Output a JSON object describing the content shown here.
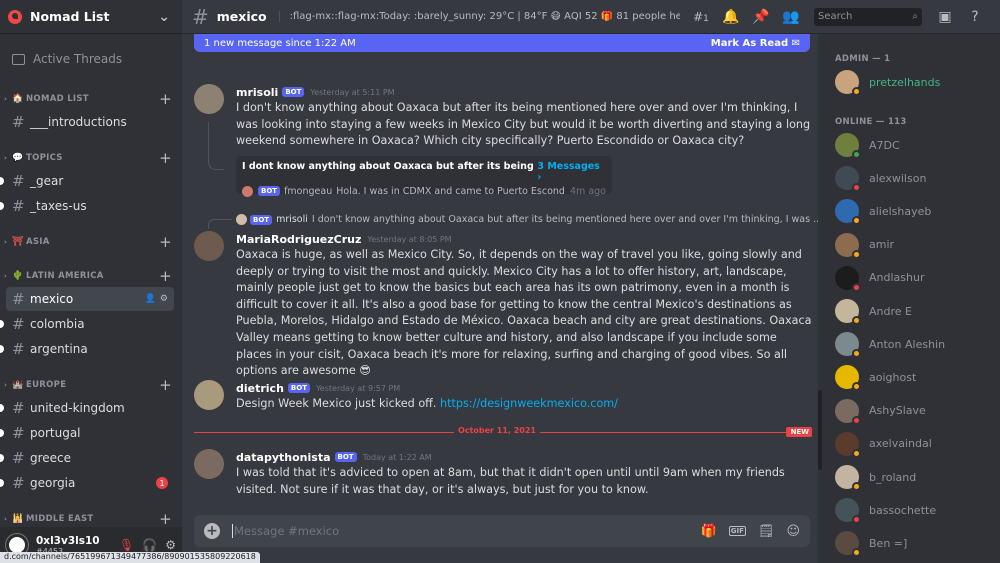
{
  "server": {
    "name": "Nomad List"
  },
  "sidebar": {
    "active_threads": "Active Threads",
    "categories": [
      {
        "name": "NOMAD LIST",
        "emoji": "🏠",
        "channels": [
          {
            "name": "___introductions",
            "unread": false
          }
        ]
      },
      {
        "name": "TOPICS",
        "emoji": "💬",
        "channels": [
          {
            "name": "_gear",
            "unread": true
          },
          {
            "name": "_taxes-us",
            "unread": true
          }
        ]
      },
      {
        "name": "ASIA",
        "emoji": "⛩",
        "channels": []
      },
      {
        "name": "LATIN AMERICA",
        "emoji": "🌵",
        "channels": [
          {
            "name": "mexico",
            "selected": true
          },
          {
            "name": "colombia",
            "unread": true
          },
          {
            "name": "argentina",
            "unread": true
          }
        ]
      },
      {
        "name": "EUROPE",
        "emoji": "🏰",
        "channels": [
          {
            "name": "united-kingdom",
            "unread": true
          },
          {
            "name": "portugal",
            "unread": true
          },
          {
            "name": "greece",
            "unread": true
          },
          {
            "name": "georgia",
            "unread": true,
            "badge": "1"
          }
        ]
      },
      {
        "name": "MIDDLE EAST",
        "emoji": "🕌",
        "channels": []
      }
    ]
  },
  "user": {
    "name": "0xl3v3ls10",
    "tag": "#4453"
  },
  "status_url": "d.com/channels/765199671349477386/890901535809220618",
  "topbar": {
    "channel": "mexico",
    "topic": ":flag-mx::flag-mx:Today: :barely_sunny: 29°C | 84°F 😷 AQI 52 🎁 81 people here now [ ...",
    "thread_count": "1",
    "search_placeholder": "Search"
  },
  "banner": {
    "text": "1 new message since 1:22 AM",
    "action": "Mark As Read"
  },
  "messages": [
    {
      "author": "mrisoli",
      "bot": "BOT",
      "time": "Yesterday at 5:11 PM",
      "text": "I don't know anything about Oaxaca but after its being mentioned here over and over I'm thinking, I was looking into staying a few weeks in Mexico City but would it be worth diverting and staying a long weekend somewhere in Oaxaca? Which city specifically? Puerto Escondido or Oaxaca city?",
      "thread": {
        "title": "I dont know anything about Oaxaca but after its being mentione...",
        "count": "3 Messages ›",
        "last_bot": "BOT",
        "last_user": "fmongeau",
        "last_text": "Hola. I was in CDMX and came to Puerto Escondid...",
        "last_time": "4m ago"
      }
    },
    {
      "reply": {
        "bot": "BOT",
        "user": "mrisoli",
        "text": "I don't know anything about Oaxaca but after its being mentioned here over and over I'm thinking, I was ..."
      },
      "author": "MariaRodriguezCruz",
      "time": "Yesterday at 8:05 PM",
      "text": "Oaxaca is huge, as well as Mexico City. So, it depends on the way of travel you like, going slowly and deeply or trying to visit the most and quickly. Mexico City has a lot to offer history, art, landscape, mainly people just get to know the basics but each area has its own patrimony, even in a month is difficult to cover it all. It's also a good base for getting to know the central Mexico's destinations as Puebla, Morelos, Hidalgo and Estado de México. Oaxaca beach and city are great destinations. Oaxaca Valley means getting to know better culture and history, and also landscape if you include some places in your cisit, Oaxaca beach it's more for relaxing, surfing and charging of good vibes.  So all options are awesome 😎"
    },
    {
      "author": "dietrich",
      "bot": "BOT",
      "time": "Yesterday at 9:57 PM",
      "text": "Design Week Mexico just kicked off. ",
      "link": "https://designweekmexico.com/"
    },
    {
      "author": "datapythonista",
      "bot": "BOT",
      "time": "Today at 1:22 AM",
      "text": "I was told that it's adviced to open at 8am, but that it didn't open until until 9am when my friends visited. Not sure if it was that day, or it's always, but just for you to know."
    }
  ],
  "divider": {
    "date": "October 11, 2021",
    "new_label": "NEW"
  },
  "composer": {
    "placeholder": "Message #mexico"
  },
  "members": {
    "admin_header": "ADMIN — 1",
    "online_header": "ONLINE — 113",
    "admins": [
      {
        "name": "pretzelhands",
        "status": "idle"
      }
    ],
    "online": [
      {
        "name": "A7DC",
        "status": "online"
      },
      {
        "name": "alexwilson",
        "status": "dnd"
      },
      {
        "name": "alielshayeb",
        "status": "idle"
      },
      {
        "name": "amir",
        "status": "idle"
      },
      {
        "name": "Andlashur",
        "status": "dnd"
      },
      {
        "name": "Andre E",
        "status": "idle"
      },
      {
        "name": "Anton Aleshin",
        "status": "idle"
      },
      {
        "name": "aoighost",
        "status": "idle"
      },
      {
        "name": "AshySlave",
        "status": "dnd"
      },
      {
        "name": "axelvaindal",
        "status": "idle"
      },
      {
        "name": "b_roland",
        "status": "idle"
      },
      {
        "name": "bassochette",
        "status": "dnd"
      },
      {
        "name": "Ben =]",
        "status": "idle"
      }
    ]
  },
  "colors": {
    "online": "#3ba55c",
    "idle": "#faa81a",
    "dnd": "#ed4245",
    "blurple": "#5865f2",
    "link": "#00b0f4"
  }
}
